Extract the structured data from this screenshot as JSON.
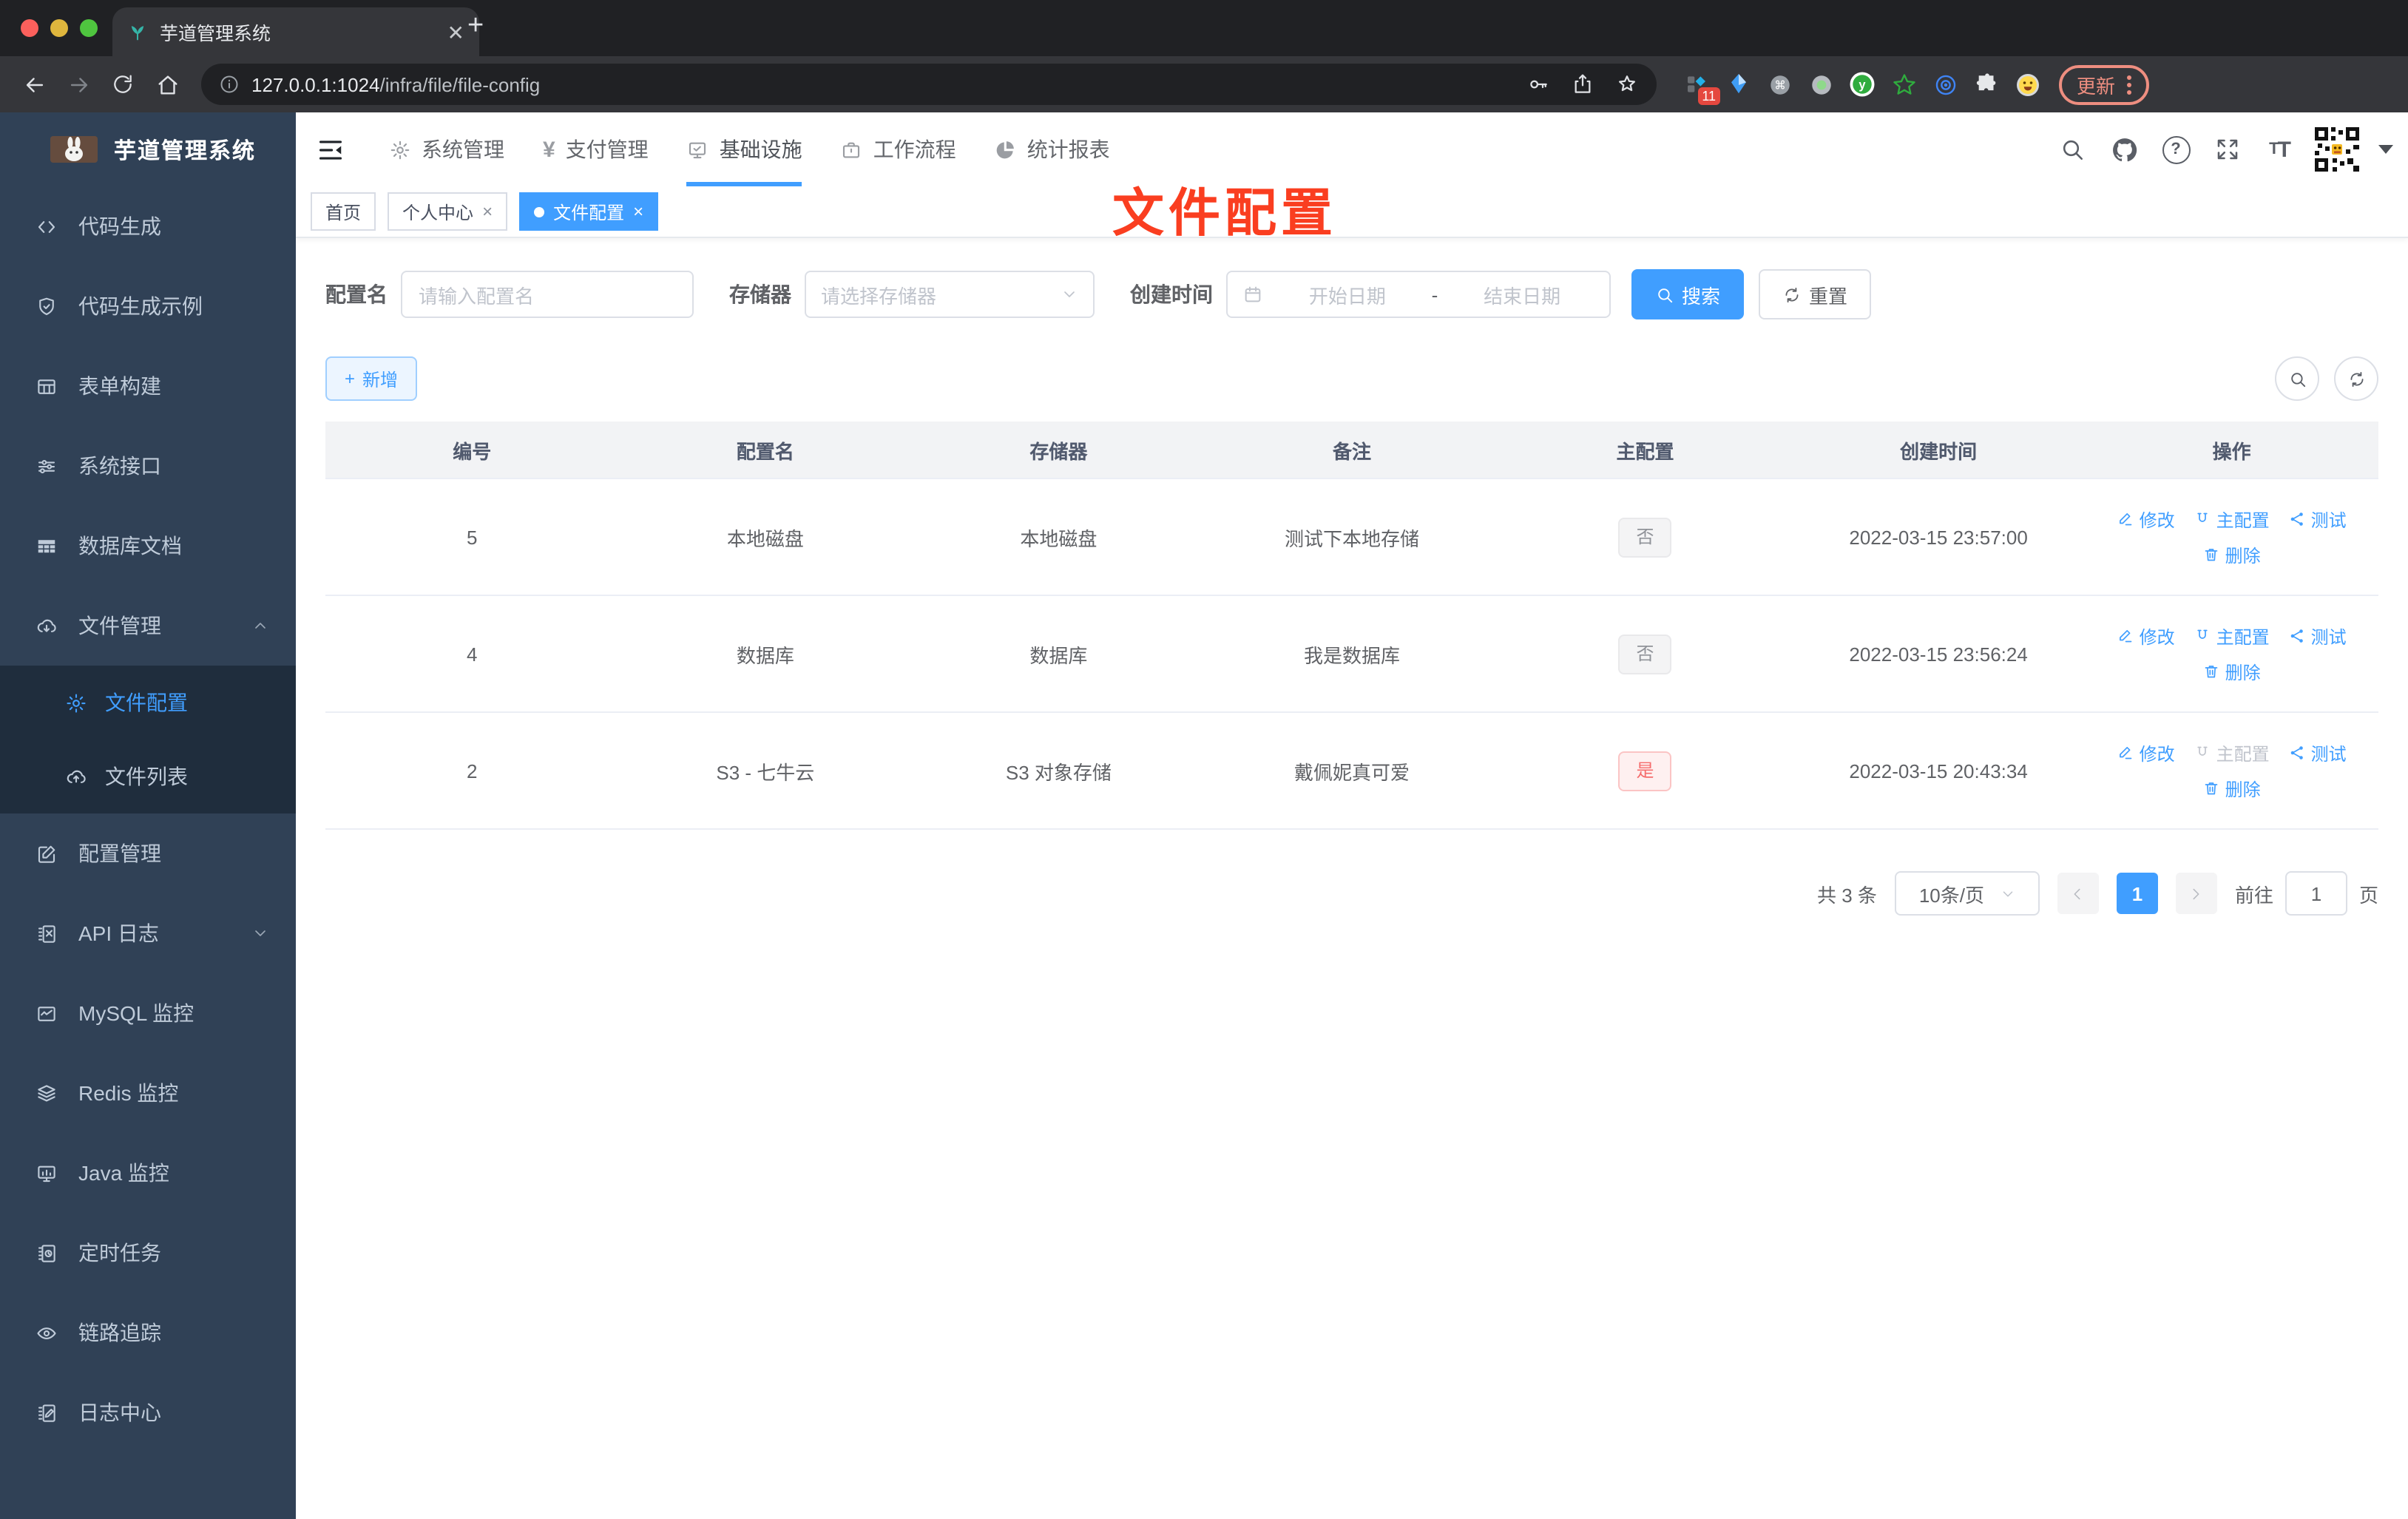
{
  "colors": {
    "accent": "#409eff",
    "danger": "#f56c6c",
    "annotation_red": "#fa3e20",
    "sidebar_bg": "#304156",
    "submenu_bg": "#1f2d3d"
  },
  "browser": {
    "tab_title": "芋道管理系统",
    "url_host": "127.0.0.1:1024",
    "url_path": "/infra/file/file-config",
    "ext_badge": "11",
    "update_label": "更新"
  },
  "annotation": {
    "text": "文件配置"
  },
  "sidebar": {
    "title": "芋道管理系统",
    "items": [
      {
        "label": "代码生成"
      },
      {
        "label": "代码生成示例"
      },
      {
        "label": "表单构建"
      },
      {
        "label": "系统接口"
      },
      {
        "label": "数据库文档"
      },
      {
        "label": "文件管理"
      },
      {
        "label": "文件配置"
      },
      {
        "label": "文件列表"
      },
      {
        "label": "配置管理"
      },
      {
        "label": "API 日志"
      },
      {
        "label": "MySQL 监控"
      },
      {
        "label": "Redis 监控"
      },
      {
        "label": "Java 监控"
      },
      {
        "label": "定时任务"
      },
      {
        "label": "链路追踪"
      },
      {
        "label": "日志中心"
      }
    ]
  },
  "topnav": {
    "items": [
      {
        "label": "系统管理"
      },
      {
        "label": "支付管理"
      },
      {
        "label": "基础设施"
      },
      {
        "label": "工作流程"
      },
      {
        "label": "统计报表"
      }
    ]
  },
  "tabs": [
    {
      "label": "首页"
    },
    {
      "label": "个人中心"
    },
    {
      "label": "文件配置"
    }
  ],
  "filters": {
    "name_label": "配置名",
    "name_placeholder": "请输入配置名",
    "storage_label": "存储器",
    "storage_placeholder": "请选择存储器",
    "date_label": "创建时间",
    "date_start_placeholder": "开始日期",
    "date_separator": "-",
    "date_end_placeholder": "结束日期",
    "search_label": "搜索",
    "reset_label": "重置"
  },
  "toolbar": {
    "add_label": "新增"
  },
  "table": {
    "columns": [
      "编号",
      "配置名",
      "存储器",
      "备注",
      "主配置",
      "创建时间",
      "操作"
    ],
    "rows": [
      {
        "id": "5",
        "name": "本地磁盘",
        "storage": "本地磁盘",
        "remark": "测试下本地存储",
        "master": "否",
        "master_type": "info",
        "created": "2022-03-15 23:57:00",
        "actions": {
          "edit": "修改",
          "master": "主配置",
          "test": "测试",
          "delete": "删除"
        }
      },
      {
        "id": "4",
        "name": "数据库",
        "storage": "数据库",
        "remark": "我是数据库",
        "master": "否",
        "master_type": "info",
        "created": "2022-03-15 23:56:24",
        "actions": {
          "edit": "修改",
          "master": "主配置",
          "test": "测试",
          "delete": "删除"
        }
      },
      {
        "id": "2",
        "name": "S3 - 七牛云",
        "storage": "S3 对象存储",
        "remark": "戴佩妮真可爱",
        "master": "是",
        "master_type": "danger",
        "created": "2022-03-15 20:43:34",
        "actions": {
          "edit": "修改",
          "master": "主配置",
          "test": "测试",
          "delete": "删除"
        }
      }
    ]
  },
  "pagination": {
    "total": "共 3 条",
    "page_size": "10条/页",
    "current_page": "1",
    "goto_label": "前往",
    "goto_value": "1",
    "page_unit": "页"
  }
}
